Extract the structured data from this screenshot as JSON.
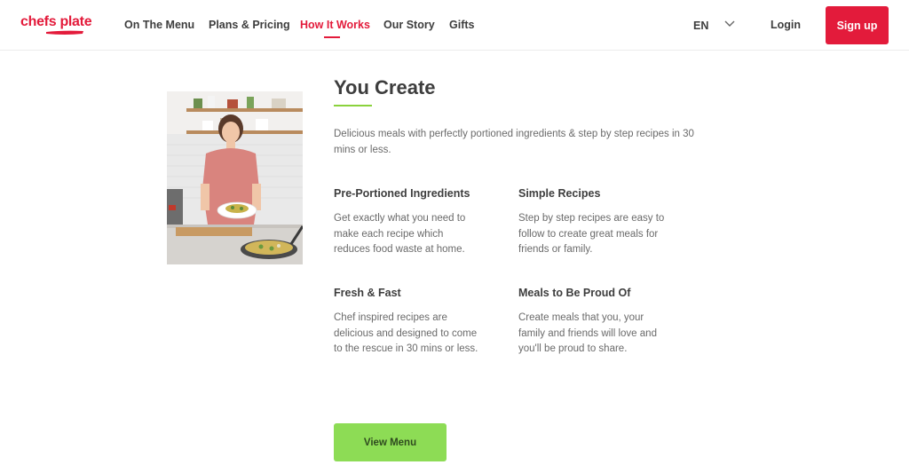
{
  "brand": {
    "logo_text": "chefs plate",
    "accent": "#e31b3b",
    "green": "#8ddc55"
  },
  "nav": {
    "items": [
      {
        "label": "On The Menu"
      },
      {
        "label": "Plans & Pricing"
      },
      {
        "label": "How It Works"
      },
      {
        "label": "Our Story"
      },
      {
        "label": "Gifts"
      }
    ],
    "active": "How It Works"
  },
  "header_right": {
    "language": "EN",
    "login": "Login",
    "signup": "Sign up"
  },
  "section": {
    "title": "You Create",
    "intro": "Delicious meals with perfectly portioned ingredients & step by step recipes in 30 mins or less.",
    "features": [
      {
        "title": "Pre-Portioned Ingredients",
        "text": "Get exactly what you need to make each recipe which reduces food waste at home."
      },
      {
        "title": "Simple Recipes",
        "text": "Step by step recipes are easy to follow to create great meals for friends or family."
      },
      {
        "title": "Fresh & Fast",
        "text": "Chef inspired recipes are delicious and designed to come to the rescue in 30 mins or less."
      },
      {
        "title": "Meals to Be Proud Of",
        "text": "Create meals that you, your family and friends will love and you'll be proud to share."
      }
    ],
    "cta": "View Menu"
  }
}
